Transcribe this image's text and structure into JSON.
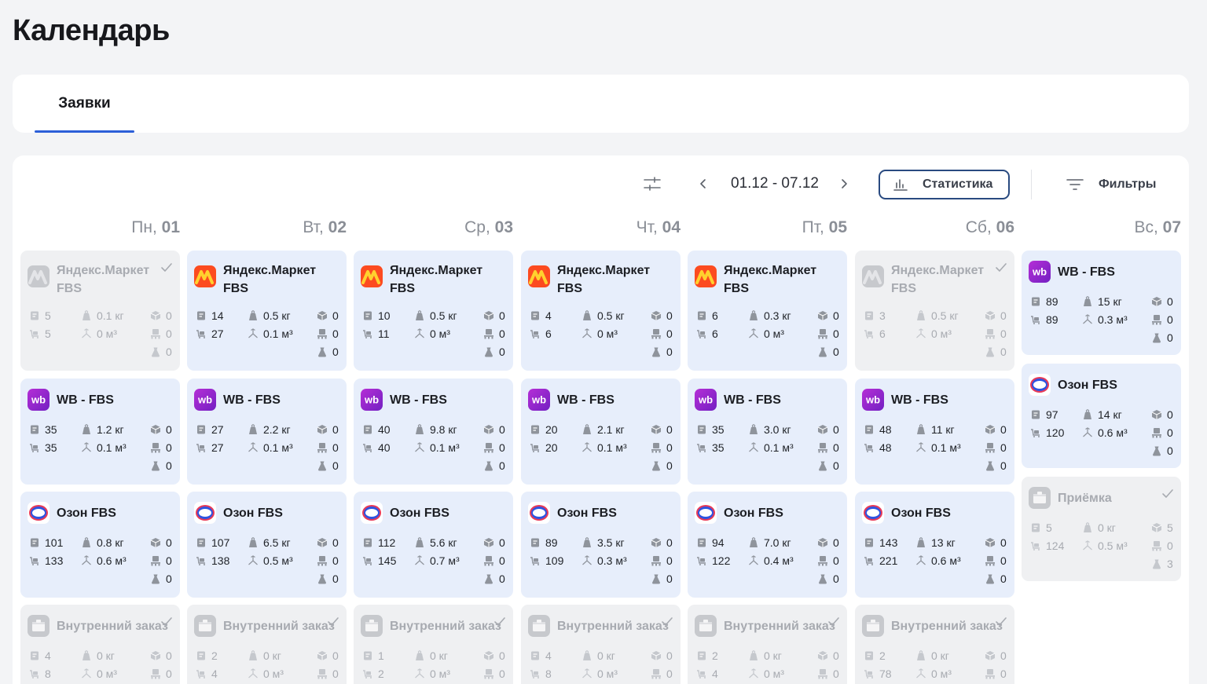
{
  "page_title": "Календарь",
  "tabs": [
    {
      "label": "Заявки"
    }
  ],
  "toolbar": {
    "date_range": "01.12 - 07.12",
    "stats_label": "Статистика",
    "filters_label": "Фильтры"
  },
  "days": [
    {
      "name": "Пн,",
      "num": "01"
    },
    {
      "name": "Вт,",
      "num": "02"
    },
    {
      "name": "Ср,",
      "num": "03"
    },
    {
      "name": "Чт,",
      "num": "04"
    },
    {
      "name": "Пт,",
      "num": "05"
    },
    {
      "name": "Сб,",
      "num": "06"
    },
    {
      "name": "Вс,",
      "num": "07"
    }
  ],
  "cards": [
    {
      "col": 0,
      "row": 0,
      "type": "ym",
      "muted": true,
      "checked": true,
      "name": "Яндекс.Маркет FBS",
      "docs": "5",
      "rows": "5",
      "weight": "0.1 кг",
      "volume": "0 м³",
      "boxes": "0",
      "pallets": "0",
      "bags": "0"
    },
    {
      "col": 1,
      "row": 0,
      "type": "ym",
      "muted": false,
      "checked": false,
      "name": "Яндекс.Маркет FBS",
      "docs": "14",
      "rows": "27",
      "weight": "0.5 кг",
      "volume": "0.1 м³",
      "boxes": "0",
      "pallets": "0",
      "bags": "0"
    },
    {
      "col": 2,
      "row": 0,
      "type": "ym",
      "muted": false,
      "checked": false,
      "name": "Яндекс.Маркет FBS",
      "docs": "10",
      "rows": "11",
      "weight": "0.5 кг",
      "volume": "0 м³",
      "boxes": "0",
      "pallets": "0",
      "bags": "0"
    },
    {
      "col": 3,
      "row": 0,
      "type": "ym",
      "muted": false,
      "checked": false,
      "name": "Яндекс.Маркет FBS",
      "docs": "4",
      "rows": "6",
      "weight": "0.5 кг",
      "volume": "0 м³",
      "boxes": "0",
      "pallets": "0",
      "bags": "0"
    },
    {
      "col": 4,
      "row": 0,
      "type": "ym",
      "muted": false,
      "checked": false,
      "name": "Яндекс.Маркет FBS",
      "docs": "6",
      "rows": "6",
      "weight": "0.3 кг",
      "volume": "0 м³",
      "boxes": "0",
      "pallets": "0",
      "bags": "0"
    },
    {
      "col": 5,
      "row": 0,
      "type": "ym",
      "muted": true,
      "checked": true,
      "name": "Яндекс.Маркет FBS",
      "docs": "3",
      "rows": "6",
      "weight": "0.5 кг",
      "volume": "0 м³",
      "boxes": "0",
      "pallets": "0",
      "bags": "0"
    },
    {
      "col": 0,
      "row": 1,
      "type": "wb",
      "muted": false,
      "checked": false,
      "name": "WB - FBS",
      "docs": "35",
      "rows": "35",
      "weight": "1.2 кг",
      "volume": "0.1 м³",
      "boxes": "0",
      "pallets": "0",
      "bags": "0"
    },
    {
      "col": 1,
      "row": 1,
      "type": "wb",
      "muted": false,
      "checked": false,
      "name": "WB - FBS",
      "docs": "27",
      "rows": "27",
      "weight": "2.2 кг",
      "volume": "0.1 м³",
      "boxes": "0",
      "pallets": "0",
      "bags": "0"
    },
    {
      "col": 2,
      "row": 1,
      "type": "wb",
      "muted": false,
      "checked": false,
      "name": "WB - FBS",
      "docs": "40",
      "rows": "40",
      "weight": "9.8 кг",
      "volume": "0.1 м³",
      "boxes": "0",
      "pallets": "0",
      "bags": "0"
    },
    {
      "col": 3,
      "row": 1,
      "type": "wb",
      "muted": false,
      "checked": false,
      "name": "WB - FBS",
      "docs": "20",
      "rows": "20",
      "weight": "2.1 кг",
      "volume": "0.1 м³",
      "boxes": "0",
      "pallets": "0",
      "bags": "0"
    },
    {
      "col": 4,
      "row": 1,
      "type": "wb",
      "muted": false,
      "checked": false,
      "name": "WB - FBS",
      "docs": "35",
      "rows": "35",
      "weight": "3.0 кг",
      "volume": "0.1 м³",
      "boxes": "0",
      "pallets": "0",
      "bags": "0"
    },
    {
      "col": 5,
      "row": 1,
      "type": "wb",
      "muted": false,
      "checked": false,
      "name": "WB - FBS",
      "docs": "48",
      "rows": "48",
      "weight": "11 кг",
      "volume": "0.1 м³",
      "boxes": "0",
      "pallets": "0",
      "bags": "0"
    },
    {
      "col": 0,
      "row": 2,
      "type": "oz",
      "muted": false,
      "checked": false,
      "name": "Озон FBS",
      "docs": "101",
      "rows": "133",
      "weight": "0.8 кг",
      "volume": "0.6 м³",
      "boxes": "0",
      "pallets": "0",
      "bags": "0"
    },
    {
      "col": 1,
      "row": 2,
      "type": "oz",
      "muted": false,
      "checked": false,
      "name": "Озон FBS",
      "docs": "107",
      "rows": "138",
      "weight": "6.5 кг",
      "volume": "0.5 м³",
      "boxes": "0",
      "pallets": "0",
      "bags": "0"
    },
    {
      "col": 2,
      "row": 2,
      "type": "oz",
      "muted": false,
      "checked": false,
      "name": "Озон FBS",
      "docs": "112",
      "rows": "145",
      "weight": "5.6 кг",
      "volume": "0.7 м³",
      "boxes": "0",
      "pallets": "0",
      "bags": "0"
    },
    {
      "col": 3,
      "row": 2,
      "type": "oz",
      "muted": false,
      "checked": false,
      "name": "Озон FBS",
      "docs": "89",
      "rows": "109",
      "weight": "3.5 кг",
      "volume": "0.3 м³",
      "boxes": "0",
      "pallets": "0",
      "bags": "0"
    },
    {
      "col": 4,
      "row": 2,
      "type": "oz",
      "muted": false,
      "checked": false,
      "name": "Озон FBS",
      "docs": "94",
      "rows": "122",
      "weight": "7.0 кг",
      "volume": "0.4 м³",
      "boxes": "0",
      "pallets": "0",
      "bags": "0"
    },
    {
      "col": 5,
      "row": 2,
      "type": "oz",
      "muted": false,
      "checked": false,
      "name": "Озон FBS",
      "docs": "143",
      "rows": "221",
      "weight": "13 кг",
      "volume": "0.6 м³",
      "boxes": "0",
      "pallets": "0",
      "bags": "0"
    },
    {
      "col": 0,
      "row": 3,
      "type": "box",
      "muted": true,
      "checked": true,
      "name": "Внутренний заказ",
      "docs": "4",
      "rows": "8",
      "weight": "0 кг",
      "volume": "0 м³",
      "boxes": "0",
      "pallets": "0",
      "bags": ""
    },
    {
      "col": 1,
      "row": 3,
      "type": "box",
      "muted": true,
      "checked": true,
      "name": "Внутренний заказ",
      "docs": "2",
      "rows": "4",
      "weight": "0 кг",
      "volume": "0 м³",
      "boxes": "0",
      "pallets": "0",
      "bags": ""
    },
    {
      "col": 2,
      "row": 3,
      "type": "box",
      "muted": true,
      "checked": true,
      "name": "Внутренний заказ",
      "docs": "1",
      "rows": "2",
      "weight": "0 кг",
      "volume": "0 м³",
      "boxes": "0",
      "pallets": "0",
      "bags": ""
    },
    {
      "col": 3,
      "row": 3,
      "type": "box",
      "muted": true,
      "checked": true,
      "name": "Внутренний заказ",
      "docs": "4",
      "rows": "8",
      "weight": "0 кг",
      "volume": "0 м³",
      "boxes": "0",
      "pallets": "0",
      "bags": ""
    },
    {
      "col": 4,
      "row": 3,
      "type": "box",
      "muted": true,
      "checked": true,
      "name": "Внутренний заказ",
      "docs": "2",
      "rows": "4",
      "weight": "0 кг",
      "volume": "0 м³",
      "boxes": "0",
      "pallets": "0",
      "bags": ""
    },
    {
      "col": 5,
      "row": 3,
      "type": "box",
      "muted": true,
      "checked": true,
      "name": "Внутренний заказ",
      "docs": "2",
      "rows": "78",
      "weight": "0 кг",
      "volume": "0 м³",
      "boxes": "0",
      "pallets": "0",
      "bags": ""
    },
    {
      "col": 6,
      "row": 0,
      "type": "wb",
      "muted": false,
      "checked": false,
      "single": true,
      "name": "WB - FBS",
      "docs": "89",
      "rows": "89",
      "weight": "15 кг",
      "volume": "0.3 м³",
      "boxes": "0",
      "pallets": "0",
      "bags": "0"
    },
    {
      "col": 6,
      "row": 1,
      "type": "oz",
      "muted": false,
      "checked": false,
      "single": true,
      "name": "Озон FBS",
      "docs": "97",
      "rows": "120",
      "weight": "14 кг",
      "volume": "0.6 м³",
      "boxes": "0",
      "pallets": "0",
      "bags": "0"
    },
    {
      "col": 6,
      "row": 2,
      "type": "box",
      "muted": true,
      "checked": true,
      "single": true,
      "name": "Приёмка",
      "docs": "5",
      "rows": "124",
      "weight": "0 кг",
      "volume": "0.5 м³",
      "boxes": "5",
      "pallets": "0",
      "bags": "3"
    }
  ],
  "icons": {
    "adjust": "sliders-icon",
    "prev": "chevron-left-icon",
    "next": "chevron-right-icon",
    "stats": "bar-chart-icon",
    "filters": "filter-lines-icon"
  }
}
